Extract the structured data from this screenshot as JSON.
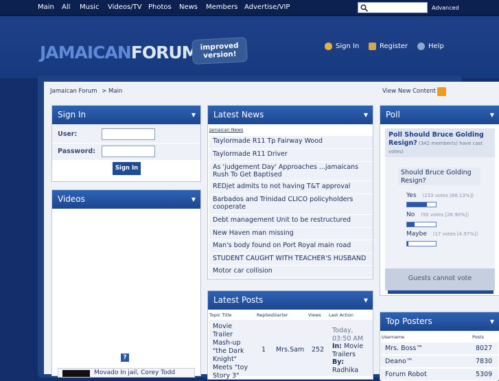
{
  "nav": {
    "items": [
      "Main",
      "All",
      "Music",
      "Videos/TV",
      "Photos",
      "News",
      "Members",
      "Advertise/VIP"
    ],
    "advanced": "Advanced"
  },
  "logo": {
    "part1": "JAMAICAN",
    "part2": "FORUM",
    "badge_line1": "improved",
    "badge_line2": "version!"
  },
  "header_links": {
    "signin": "Sign In",
    "register": "Register",
    "help": "Help"
  },
  "breadcrumb": {
    "root": "Jamaican Forum",
    "sep": ">",
    "current": "Main"
  },
  "view_new": "View New Content",
  "signin_panel": {
    "title": "Sign In",
    "user_label": "User:",
    "password_label": "Password:",
    "button": "Sign In"
  },
  "videos_panel": {
    "title": "Videos",
    "help": "?",
    "item": "Movado In jail, Corey Todd"
  },
  "news_panel": {
    "title": "Latest News",
    "source": "Jamaican News",
    "items": [
      "Taylormade R11 Tp Fairway Wood",
      "Taylormade R11 Driver",
      "As 'judgement Day' Approaches ...jamaicans Rush To Get Baptised",
      "REDjet admits to not having T&T approval",
      "Barbados and Trinidad CLICO policyholders cooperate",
      "Debt management Unit to be restructured",
      "New Haven man missing",
      "Man's body found on Port Royal main road",
      "STUDENT CAUGHT WITH TEACHER'S HUSBAND",
      "Motor car collision"
    ]
  },
  "posts_panel": {
    "title": "Latest Posts",
    "headers": {
      "topic": "Topic Title",
      "replies": "Replies",
      "starter": "Starter",
      "views": "Views",
      "action": "Last Action"
    },
    "row": {
      "topic": "Movie Trailer Mash-up \"the Dark Knight\" Meets \"toy Story 3\"",
      "replies": "1",
      "starter": "Mrs.Sam",
      "views": "252",
      "time": "Today, 03:50 AM",
      "in_label": "In:",
      "in_value": "Movie Trailers",
      "by_label": "By:",
      "by_value": "Radhika"
    }
  },
  "poll_panel": {
    "title": "Poll",
    "question_title": "Poll Should Bruce Golding Resign?",
    "voted": "(342 member(s) have cast votes)",
    "question": "Should Bruce Golding Resign?",
    "options": [
      {
        "label": "Yes",
        "votes": "(233 votes [68.13%])",
        "fraction": 0.6813
      },
      {
        "label": "No",
        "votes": "(92 votes [26.90%])",
        "fraction": 0.269
      },
      {
        "label": "Maybe",
        "votes": "(17 votes [4.97%])",
        "fraction": 0.0497
      }
    ],
    "guests": "Guests cannot vote"
  },
  "posters_panel": {
    "title": "Top Posters",
    "headers": {
      "username": "Username",
      "posts": "Posts"
    },
    "rows": [
      {
        "name": "Mrs. Boss™",
        "posts": "8027"
      },
      {
        "name": "Deano™",
        "posts": "7830"
      },
      {
        "name": "Forum Robot",
        "posts": "5309"
      }
    ]
  },
  "colors": {
    "nav_bg": "#0d2150",
    "page_bg": "#142e6b",
    "panel_header": "#2d63b4",
    "row_bg": "#eef2f8",
    "accent": "#1f4a94"
  }
}
